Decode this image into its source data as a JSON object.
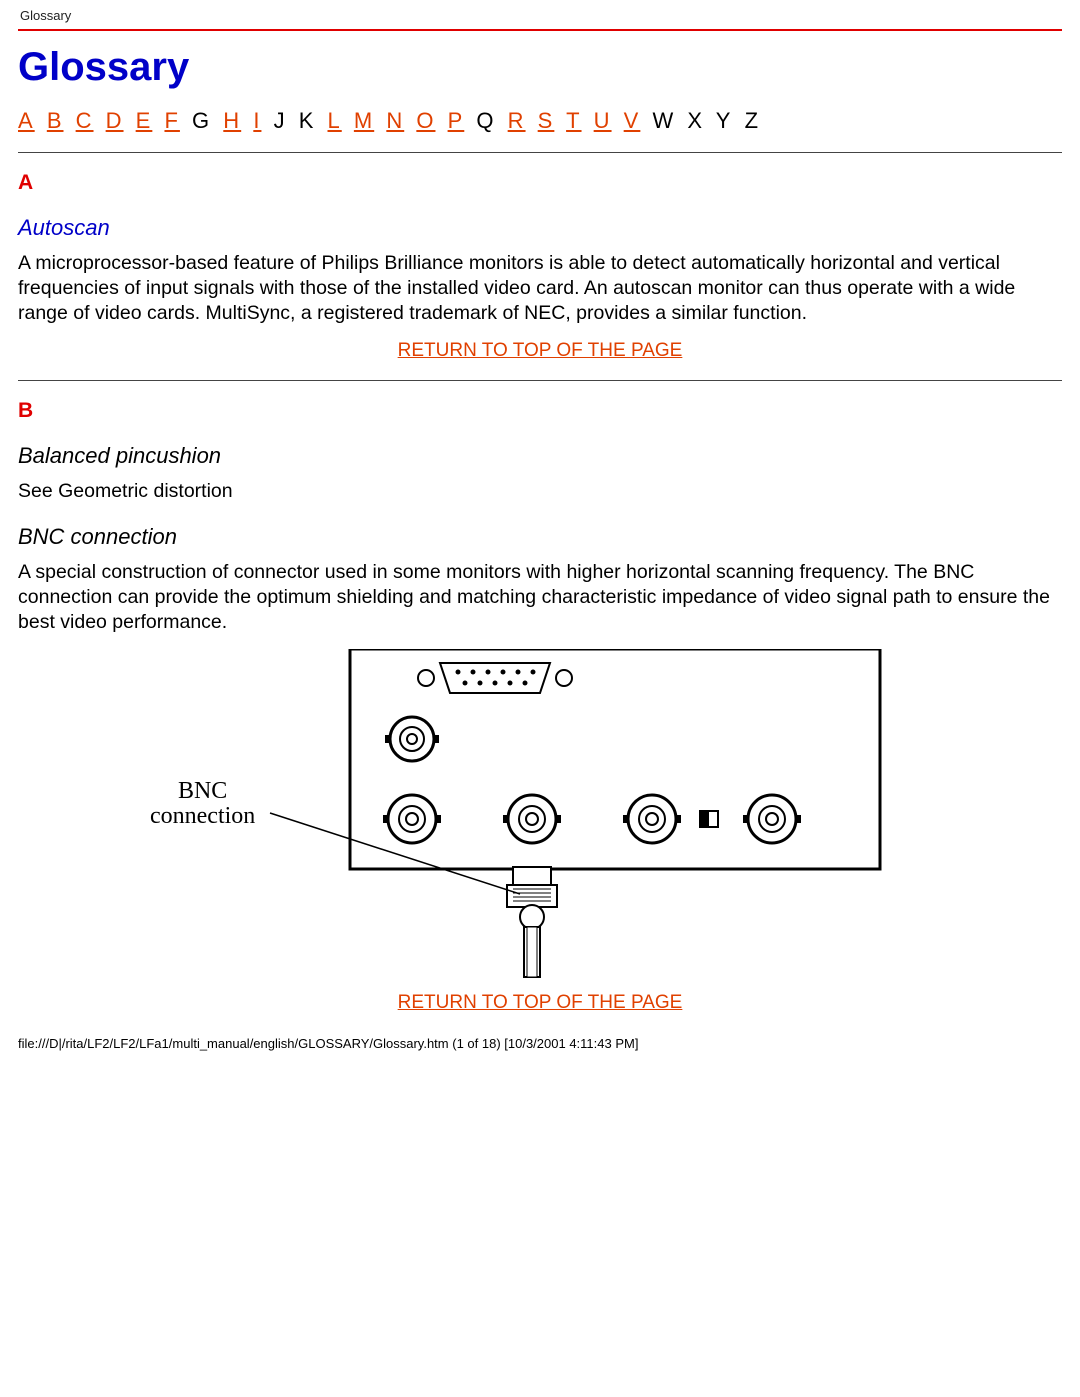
{
  "header_small": "Glossary",
  "title": "Glossary",
  "alpha": [
    {
      "t": "A",
      "link": true
    },
    {
      "t": "B",
      "link": true
    },
    {
      "t": "C",
      "link": true
    },
    {
      "t": "D",
      "link": true
    },
    {
      "t": "E",
      "link": true
    },
    {
      "t": "F",
      "link": true
    },
    {
      "t": "G",
      "link": false
    },
    {
      "t": "H",
      "link": true
    },
    {
      "t": "I",
      "link": true
    },
    {
      "t": "J",
      "link": false
    },
    {
      "t": "K",
      "link": false
    },
    {
      "t": "L",
      "link": true
    },
    {
      "t": "M",
      "link": true
    },
    {
      "t": "N",
      "link": true
    },
    {
      "t": "O",
      "link": true
    },
    {
      "t": "P",
      "link": true
    },
    {
      "t": "Q",
      "link": false
    },
    {
      "t": "R",
      "link": true
    },
    {
      "t": "S",
      "link": true
    },
    {
      "t": "T",
      "link": true
    },
    {
      "t": "U",
      "link": true
    },
    {
      "t": "V",
      "link": true
    },
    {
      "t": "W",
      "link": false
    },
    {
      "t": "X",
      "link": false
    },
    {
      "t": "Y",
      "link": false
    },
    {
      "t": "Z",
      "link": false
    }
  ],
  "sections": {
    "a": {
      "letter": "A",
      "term": "Autoscan",
      "desc": "A microprocessor-based feature of Philips Brilliance monitors is able to detect automatically horizontal and vertical frequencies of input signals with those of the installed video card. An autoscan monitor can thus operate with a wide range of video cards. MultiSync, a registered trademark of NEC, provides a similar function."
    },
    "b": {
      "letter": "B",
      "term1": "Balanced pincushion",
      "desc1": "See Geometric distortion",
      "term2": "BNC connection",
      "desc2": "A special construction of connector used in some monitors with higher horizontal scanning frequency. The BNC connection can provide the optimum shielding and matching characteristic impedance of video signal path to ensure the best video performance."
    }
  },
  "return_link": "RETURN TO TOP OF THE PAGE",
  "diagram": {
    "label_line1": "BNC",
    "label_line2": "connection"
  },
  "footer": "file:///D|/rita/LF2/LF2/LFa1/multi_manual/english/GLOSSARY/Glossary.htm (1 of 18) [10/3/2001 4:11:43 PM]"
}
